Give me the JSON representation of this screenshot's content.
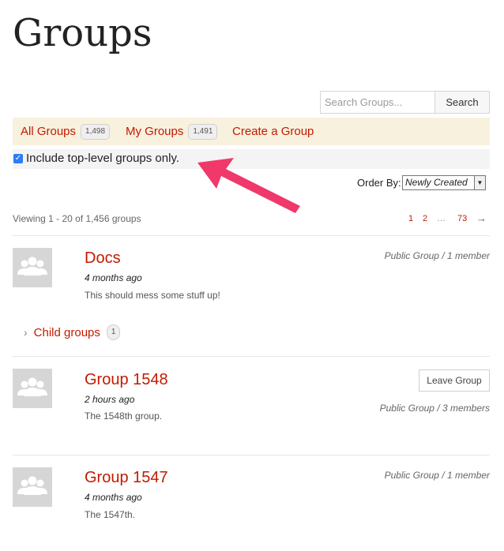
{
  "page": {
    "title": "Groups"
  },
  "search": {
    "placeholder": "Search Groups...",
    "button_label": "Search"
  },
  "tabs": [
    {
      "label": "All Groups",
      "count": "1,498"
    },
    {
      "label": "My Groups",
      "count": "1,491"
    },
    {
      "label": "Create a Group"
    }
  ],
  "filter": {
    "label": "Include top-level groups only.",
    "checked": true
  },
  "order": {
    "label": "Order By:",
    "selected": "Newly Created"
  },
  "viewing": {
    "text": "Viewing 1 - 20 of 1,456 groups"
  },
  "pagination": {
    "pages": [
      "1",
      "2",
      "…",
      "73"
    ],
    "next": "→"
  },
  "groups": [
    {
      "name": "Docs",
      "time": "4 months ago",
      "description": "This should mess some stuff up!",
      "meta": "Public Group / 1 member",
      "child_groups": {
        "label": "Child groups",
        "count": "1"
      }
    },
    {
      "name": "Group 1548",
      "time": "2 hours ago",
      "description": "The 1548th group.",
      "meta": "Public Group / 3 members",
      "action": "Leave Group"
    },
    {
      "name": "Group 1547",
      "time": "4 months ago",
      "description": "The 1547th.",
      "meta": "Public Group / 1 member"
    }
  ],
  "colors": {
    "accent": "#c31a00",
    "tab_bar_bg": "#f8f1de",
    "annotation_arrow": "#f0386b"
  },
  "icons": {
    "avatar": "group-avatar-icon",
    "chevron": "chevron-right-icon",
    "dropdown": "chevron-down-icon",
    "annotation": "arrow-annotation-icon"
  }
}
